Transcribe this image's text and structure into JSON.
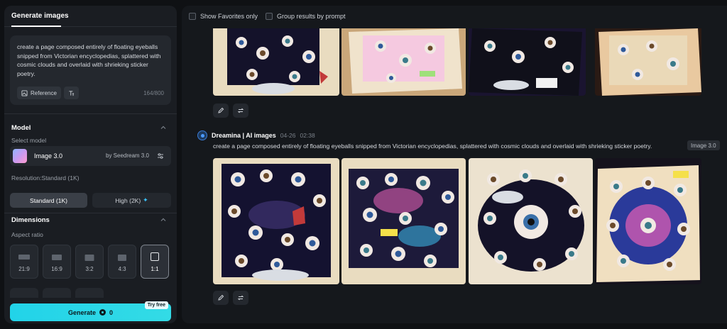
{
  "sidebar": {
    "tab_label": "Generate images",
    "prompt": "create a page composed entirely of floating eyeballs snipped from Victorian encyclopedias, splattered with cosmic clouds and overlaid with shrieking sticker poetry.",
    "reference_label": "Reference",
    "counter": "164/800",
    "model_section": "Model",
    "select_model_label": "Select model",
    "model_name": "Image 3.0",
    "model_by": "by Seedream 3.0",
    "resolution_label": "Resolution:Standard (1K)",
    "res_standard": "Standard (1K)",
    "res_high": "High (2K)",
    "dimensions_section": "Dimensions",
    "aspect_label": "Aspect ratio",
    "ratios": [
      "21:9",
      "16:9",
      "3:2",
      "4:3",
      "1:1"
    ],
    "selected_ratio": "1:1",
    "generate_label": "Generate",
    "generate_cost": "0",
    "try_free": "Try free"
  },
  "feed": {
    "show_favorites": "Show Favorites only",
    "group_results": "Group results by prompt",
    "post": {
      "author": "Dreamina | AI images",
      "date": "04-26",
      "time": "02:38",
      "prompt": "create a page composed entirely of floating eyeballs snipped from Victorian encyclopedias, splattered with cosmic clouds and overlaid with shrieking sticker poetry.",
      "model_tag": "Image 3.0"
    }
  },
  "colors": {
    "accent": "#22d3e8",
    "panel": "#1a1d22",
    "background": "#0f1114"
  }
}
